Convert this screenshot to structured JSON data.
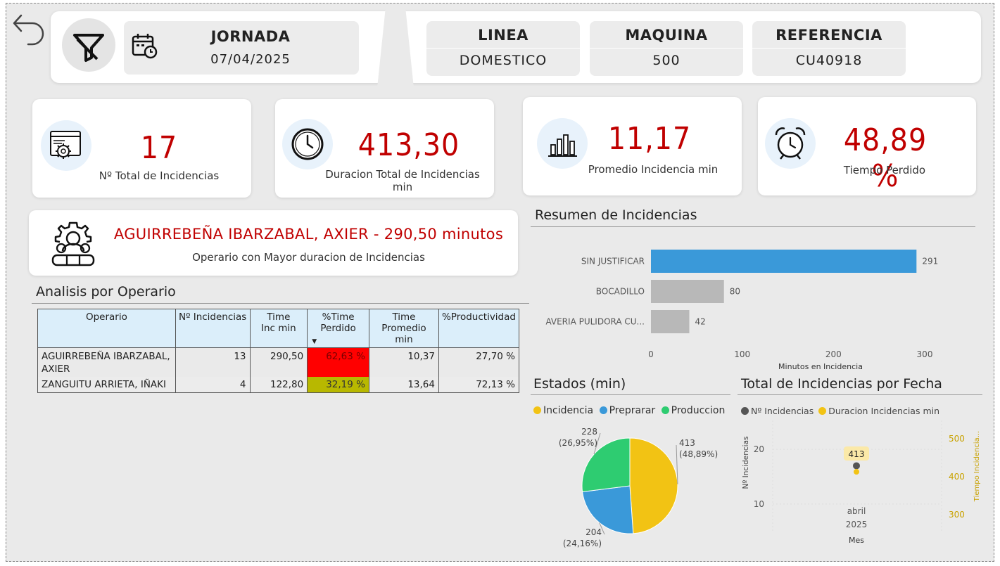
{
  "header": {
    "jornada": {
      "title": "JORNADA",
      "value": "07/04/2025"
    },
    "linea": {
      "title": "LINEA",
      "value": "DOMESTICO"
    },
    "maquina": {
      "title": "MAQUINA",
      "value": "500"
    },
    "referencia": {
      "title": "REFERENCIA",
      "value": "CU40918"
    }
  },
  "kpis": [
    {
      "value": "17",
      "label": "Nº Total de Incidencias",
      "icon": "settings-window-icon"
    },
    {
      "value": "413,30",
      "label": "Duracion Total de Incidencias min",
      "icon": "clock-icon"
    },
    {
      "value": "11,17",
      "label": "Promedio Incidencia min",
      "icon": "bar-chart-icon"
    },
    {
      "value": "48,89 %",
      "label": "Tiempo Perdido",
      "icon": "alarm-clock-icon"
    }
  ],
  "top_operator": {
    "text": "AGUIRREBEÑA IBARZABAL, AXIER - 290,50 minutos",
    "label": "Operario con Mayor duracion de Incidencias"
  },
  "operator_table": {
    "title": "Analisis por Operario",
    "columns": [
      "Operario",
      "Nº Incidencias",
      "Time Inc min",
      "%Time Perdido",
      "Time Promedio min",
      "%Productividad"
    ],
    "rows": [
      {
        "operario": "AGUIRREBEÑA IBARZABAL, AXIER",
        "incidencias": "13",
        "time_inc": "290,50",
        "time_perdido": "62,63 %",
        "promedio": "10,37",
        "productividad": "27,70 %"
      },
      {
        "operario": "ZANGUITU ARRIETA, IÑAKI",
        "incidencias": "4",
        "time_inc": "122,80",
        "time_perdido": "32,19 %",
        "promedio": "13,64",
        "productividad": "72,13 %"
      }
    ],
    "colors": {
      "high": "#ff0000",
      "mid": "#b8b800"
    }
  },
  "chart_data": [
    {
      "type": "bar",
      "orientation": "horizontal",
      "title": "Resumen de Incidencias",
      "categories": [
        "SIN JUSTIFICAR",
        "BOCADILLO",
        "AVERIA PULIDORA CU..."
      ],
      "values": [
        291,
        80,
        42
      ],
      "xlabel": "Minutos en Incidencia",
      "xlim": [
        0,
        300
      ],
      "xticks": [
        0,
        100,
        200,
        300
      ],
      "colors": [
        "#3a99d9",
        "#b8b8b8",
        "#b8b8b8"
      ]
    },
    {
      "type": "pie",
      "title": "Estados (min)",
      "legend": [
        "Incidencia",
        "Preprarar",
        "Produccion"
      ],
      "slices": [
        {
          "name": "Incidencia",
          "value": 413,
          "label": "413",
          "pct": "(48,89%)",
          "color": "#f2c314"
        },
        {
          "name": "Preprarar",
          "value": 204,
          "label": "204",
          "pct": "(24,16%)",
          "color": "#3a99d9"
        },
        {
          "name": "Produccion",
          "value": 228,
          "label": "228",
          "pct": "(26,95%)",
          "color": "#2ecc71"
        }
      ]
    },
    {
      "type": "scatter",
      "title": "Total de Incidencias por Fecha",
      "legend": [
        "Nº Incidencias",
        "Duracion Incidencias min"
      ],
      "x": [
        "abril 2025"
      ],
      "xlabel": "Mes",
      "x_tick_top": "abril",
      "x_tick_bottom": "2025",
      "y_left_label": "Nº Incidencias",
      "y_right_label": "Tiempo Incidencia...",
      "y_left_ticks": [
        "20",
        "10"
      ],
      "y_right_ticks": [
        "500",
        "400",
        "300"
      ],
      "y_left_range": [
        6,
        24
      ],
      "y_right_range": [
        270,
        530
      ],
      "series": [
        {
          "name": "Nº Incidencias",
          "values": [
            17
          ],
          "color": "#555555"
        },
        {
          "name": "Duracion Incidencias min",
          "values": [
            413
          ],
          "color": "#f2c314",
          "data_label": "413"
        }
      ]
    }
  ]
}
